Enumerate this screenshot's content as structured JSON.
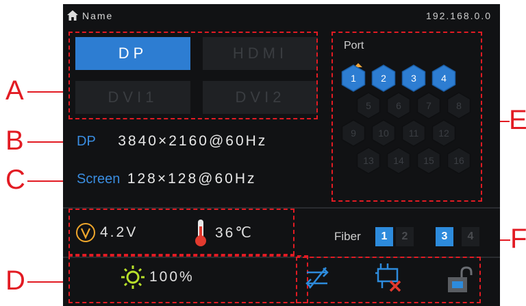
{
  "header": {
    "title": "Name",
    "ip": "192.168.0.0"
  },
  "inputs": {
    "dp": "DP",
    "hdmi": "HDMI",
    "dvi1": "DVI1",
    "dvi2": "DVI2",
    "active": "DP"
  },
  "info": {
    "source_label": "DP",
    "source_value": "3840×2160@60Hz",
    "screen_label": "Screen",
    "screen_value": "128×128@60Hz"
  },
  "ports": {
    "title": "Port",
    "active": [
      "1",
      "2",
      "3",
      "4"
    ],
    "row1": [
      "1",
      "2",
      "3",
      "4"
    ],
    "row2": [
      "5",
      "6",
      "7",
      "8"
    ],
    "row3": [
      "9",
      "10",
      "11",
      "12"
    ],
    "row4": [
      "13",
      "14",
      "15",
      "16"
    ]
  },
  "status": {
    "voltage": "4.2V",
    "temperature": "36℃",
    "brightness": "100%"
  },
  "fiber": {
    "label": "Fiber",
    "ports": [
      "1",
      "2",
      "3",
      "4"
    ],
    "active": [
      "1",
      "3"
    ]
  },
  "callouts": {
    "a": "A",
    "b": "B",
    "c": "C",
    "d": "D",
    "e": "E",
    "f": "F"
  },
  "colors": {
    "accent": "#2d7dd2",
    "annotation": "#e21b23",
    "panel": "#111214"
  }
}
